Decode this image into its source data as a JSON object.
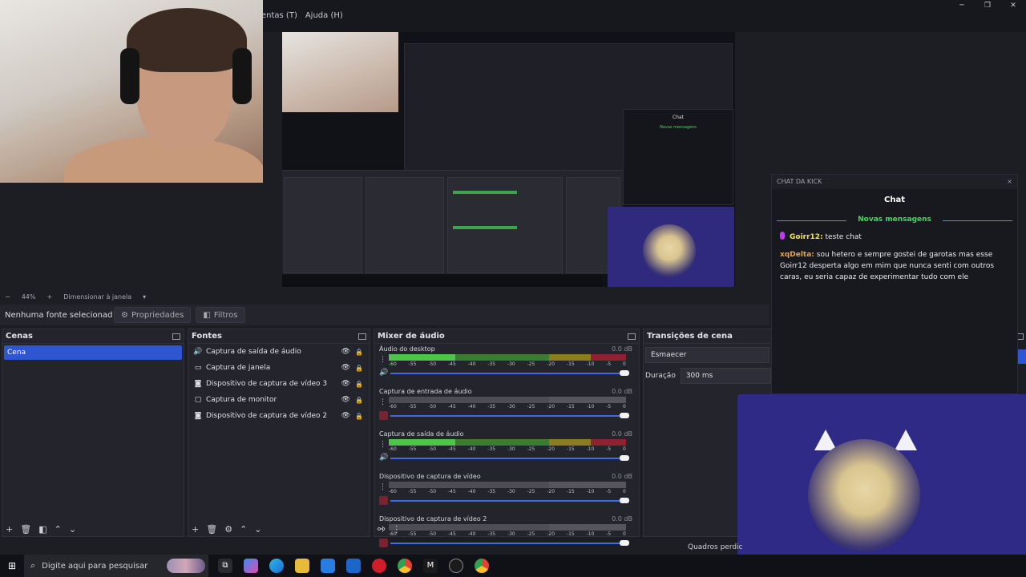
{
  "window": {
    "menus": [
      "entas (T)",
      "Ajuda (H)"
    ],
    "controls": [
      "─",
      "❐",
      "✕"
    ]
  },
  "zoom": {
    "minus": "−",
    "value": "44%",
    "plus": "+",
    "mode": "Dimensionar à janela"
  },
  "properties_bar": {
    "no_source": "Nenhuma fonte selecionad",
    "properties": "Propriedades",
    "filters": "Filtros"
  },
  "scenes": {
    "title": "Cenas",
    "items": [
      "Cena"
    ]
  },
  "sources": {
    "title": "Fontes",
    "items": [
      {
        "label": "Captura de saída de áudio",
        "icon": "speaker-icon"
      },
      {
        "label": "Captura de janela",
        "icon": "window-icon"
      },
      {
        "label": "Dispositivo de captura de vídeo 3",
        "icon": "camera-icon"
      },
      {
        "label": "Captura de monitor",
        "icon": "monitor-icon"
      },
      {
        "label": "Dispositivo de captura de vídeo 2",
        "icon": "camera-icon"
      }
    ]
  },
  "mixer": {
    "title": "Mixer de áudio",
    "ticks": [
      "-60",
      "-55",
      "-50",
      "-45",
      "-40",
      "-35",
      "-30",
      "-25",
      "-20",
      "-15",
      "-10",
      "-5",
      "0"
    ],
    "channels": [
      {
        "name": "Áudio do desktop",
        "db": "0.0 dB",
        "level": 0.28,
        "muted": false
      },
      {
        "name": "Captura de entrada de áudio",
        "db": "0.0 dB",
        "level": 0.0,
        "muted": true
      },
      {
        "name": "Captura de saída de áudio",
        "db": "0.0 dB",
        "level": 0.28,
        "muted": false
      },
      {
        "name": "Dispositivo de captura de vídeo",
        "db": "0.0 dB",
        "level": 0.0,
        "muted": true
      },
      {
        "name": "Dispositivo de captura de vídeo 2",
        "db": "0.0 dB",
        "level": 0.0,
        "muted": true
      }
    ]
  },
  "transitions": {
    "title": "Transições de cena",
    "selected": "Esmaecer",
    "duration_label": "Duração",
    "duration_value": "300 ms"
  },
  "chat": {
    "header": "CHAT DA KICK",
    "close": "×",
    "title": "Chat",
    "divider": "Novas mensagens",
    "messages": [
      {
        "user": "Goirr12:",
        "text": " teste chat"
      },
      {
        "user": "xqDelta:",
        "text": " sou hetero e sempre gostei de garotas mas esse Goirr12 desperta algo em mim que nunca senti com outros caras, eu seria capaz de experimentar tudo com ele"
      }
    ]
  },
  "status": {
    "frames": "Quadros perdic"
  },
  "taskbar": {
    "search_placeholder": "Digite aqui para pesquisar",
    "icons": [
      "task-view-icon",
      "copilot-icon",
      "edge-icon",
      "file-explorer-icon",
      "store-icon",
      "mail-icon",
      "opera-icon",
      "chrome-icon",
      "capcut-icon",
      "obs-icon",
      "chrome-alt-icon"
    ]
  },
  "colors": {
    "accent": "#2e56d2",
    "meter_green": "#4cc548",
    "chat_green": "#3fdc5a",
    "avatar_bg": "#2f2a86"
  }
}
